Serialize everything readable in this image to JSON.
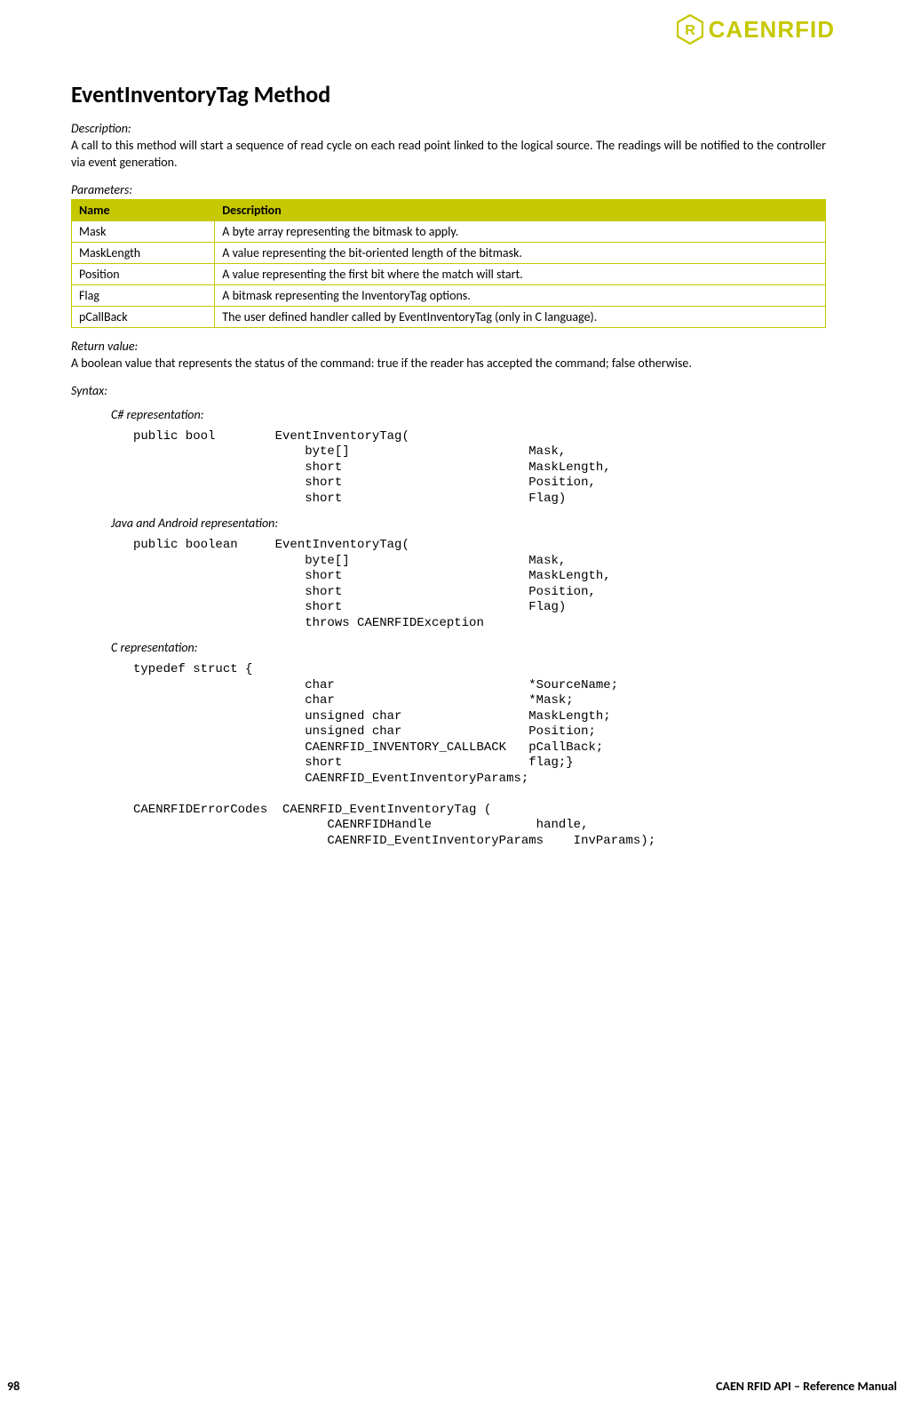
{
  "brand": "CAENRFID",
  "title": "EventInventoryTag Method",
  "desc_label": "Description:",
  "desc_text": "A call to this method will start a sequence of read cycle on each read point linked to the logical source. The readings will be notified to the controller via event generation.",
  "params_label": "Parameters:",
  "table_headers": {
    "name": "Name",
    "desc": "Description"
  },
  "params": [
    {
      "name": "Mask",
      "desc": "A byte array representing the bitmask to apply."
    },
    {
      "name": "MaskLength",
      "desc": "A value representing the bit-oriented length of the bitmask."
    },
    {
      "name": "Position",
      "desc": "A value representing the first bit where the match will start."
    },
    {
      "name": "Flag",
      "desc": "A bitmask representing the InventoryTag options."
    },
    {
      "name": "pCallBack",
      "desc": "The user defined handler called by EventInventoryTag (only in C language)."
    }
  ],
  "return_label": "Return value:",
  "return_text": "A boolean value that represents the status of the command: true if the reader has accepted the command; false otherwise.",
  "syntax_label": "Syntax:",
  "repr_csharp_label": "C# representation:",
  "repr_csharp_code": "public bool        EventInventoryTag(\n                       byte[]                        Mask,\n                       short                         MaskLength,\n                       short                         Position,\n                       short                         Flag)",
  "repr_java_label": "Java and Android representation:",
  "repr_java_code": "public boolean     EventInventoryTag(\n                       byte[]                        Mask,\n                       short                         MaskLength,\n                       short                         Position,\n                       short                         Flag)\n                       throws CAENRFIDException",
  "repr_c_label": "C representation:",
  "repr_c_code": "typedef struct {\n                       char                          *SourceName;\n                       char                          *Mask;\n                       unsigned char                 MaskLength;\n                       unsigned char                 Position;\n                       CAENRFID_INVENTORY_CALLBACK   pCallBack;\n                       short                         flag;}\n                       CAENRFID_EventInventoryParams;\n\nCAENRFIDErrorCodes  CAENRFID_EventInventoryTag (\n                          CAENRFIDHandle              handle,\n                          CAENRFID_EventInventoryParams    InvParams);",
  "page_number": "98",
  "manual_title": "CAEN RFID API – Reference Manual"
}
